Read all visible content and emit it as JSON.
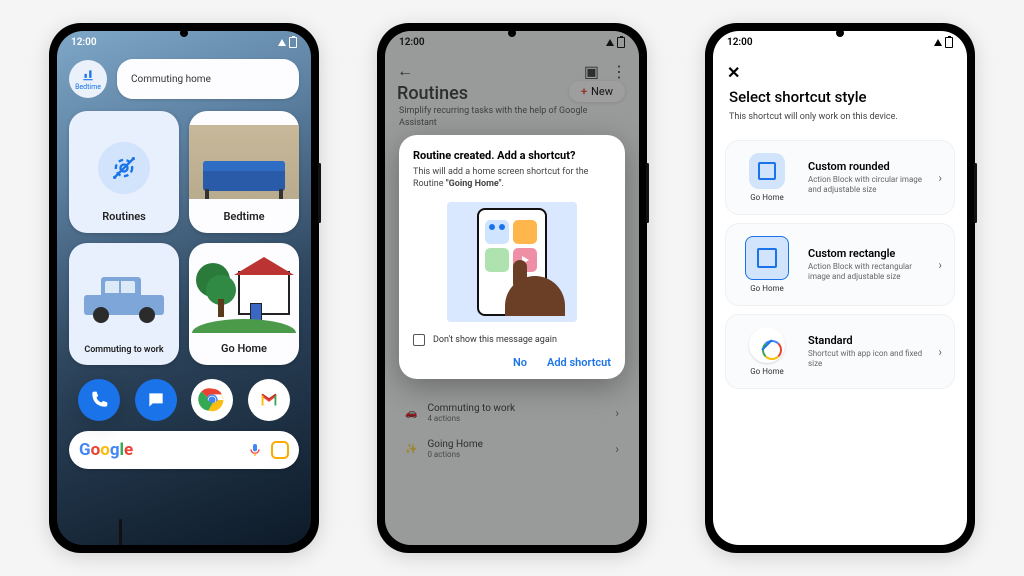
{
  "status": {
    "time": "12:00"
  },
  "phone1": {
    "chip_small_label": "Bedtime",
    "chip_wide_label": "Commuting home",
    "widgets": {
      "routines": "Routines",
      "bedtime": "Bedtime",
      "commuting": "Commuting to work",
      "gohome": "Go Home"
    },
    "search_logo": {
      "g1": "G",
      "o1": "o",
      "o2": "o",
      "g2": "g",
      "l": "l",
      "e": "e"
    }
  },
  "phone2": {
    "appbar_title": "Routines",
    "subtitle": "Simplify recurring tasks with the help of Google Assistant",
    "new_label": "New",
    "list": {
      "item1": {
        "title": "Commuting to work",
        "sub": "4 actions"
      },
      "item2": {
        "title": "Going Home",
        "sub": "0 actions"
      }
    },
    "dialog": {
      "title": "Routine created. Add a shortcut?",
      "body_a": "This will add a home screen shortcut for the Routine ",
      "body_b": "\"Going Home\"",
      "body_c": ".",
      "checkbox": "Don't show this message again",
      "no": "No",
      "yes": "Add shortcut"
    }
  },
  "phone3": {
    "title": "Select shortcut style",
    "note": "This shortcut will only work on this device.",
    "preview_label": "Go Home",
    "opts": {
      "rounded": {
        "t": "Custom rounded",
        "d": "Action Block with circular image and adjustable size"
      },
      "rect": {
        "t": "Custom rectangle",
        "d": "Action Block with rectangular image and adjustable size"
      },
      "std": {
        "t": "Standard",
        "d": "Shortcut with app icon and fixed size"
      }
    }
  }
}
